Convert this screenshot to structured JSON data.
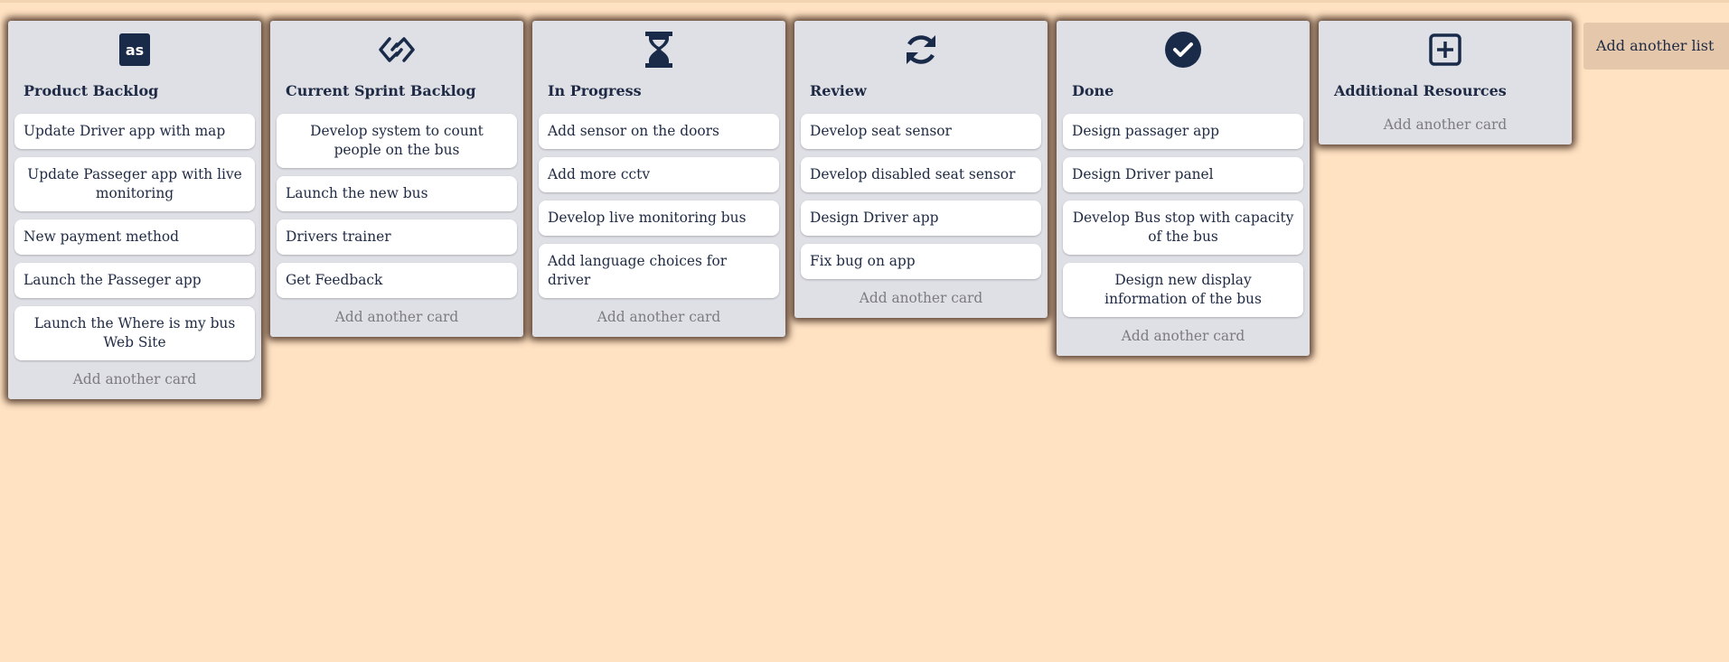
{
  "add_list_label": "Add another list",
  "lists": [
    {
      "title": "Product Backlog",
      "icon": "lastfm-icon",
      "cards": [
        "Update Driver app with map",
        "Update Passeger app with live monitoring",
        "New payment method",
        "Launch the Passeger app",
        "Launch the Where is my bus Web Site"
      ],
      "add_card_label": "Add another card"
    },
    {
      "title": "Current Sprint Backlog",
      "icon": "diamond-link-icon",
      "cards": [
        "Develop system to count people on the bus",
        "Launch the new bus",
        "Drivers trainer",
        "Get Feedback"
      ],
      "add_card_label": "Add another card"
    },
    {
      "title": "In Progress",
      "icon": "hourglass-icon",
      "cards": [
        "Add sensor on the doors",
        "Add more cctv",
        "Develop live monitoring bus",
        "Add language choices for driver"
      ],
      "add_card_label": "Add another card"
    },
    {
      "title": "Review",
      "icon": "refresh-icon",
      "cards": [
        "Develop seat sensor",
        "Develop disabled seat sensor",
        "Design Driver app",
        "Fix bug on app"
      ],
      "add_card_label": "Add another card"
    },
    {
      "title": "Done",
      "icon": "check-circle-icon",
      "cards": [
        "Design passager app",
        "Design Driver panel",
        "Develop Bus stop with capacity of the bus",
        "Design new display information of the bus"
      ],
      "add_card_label": "Add another card"
    },
    {
      "title": "Additional Resources",
      "icon": "plus-square-icon",
      "cards": [],
      "add_card_label": "Add another card"
    }
  ],
  "colors": {
    "background": "#ffe2c2",
    "list_background": "#dfe0e6",
    "icon_color": "#1a2b4a",
    "add_list_background": "#e5c8ab"
  }
}
